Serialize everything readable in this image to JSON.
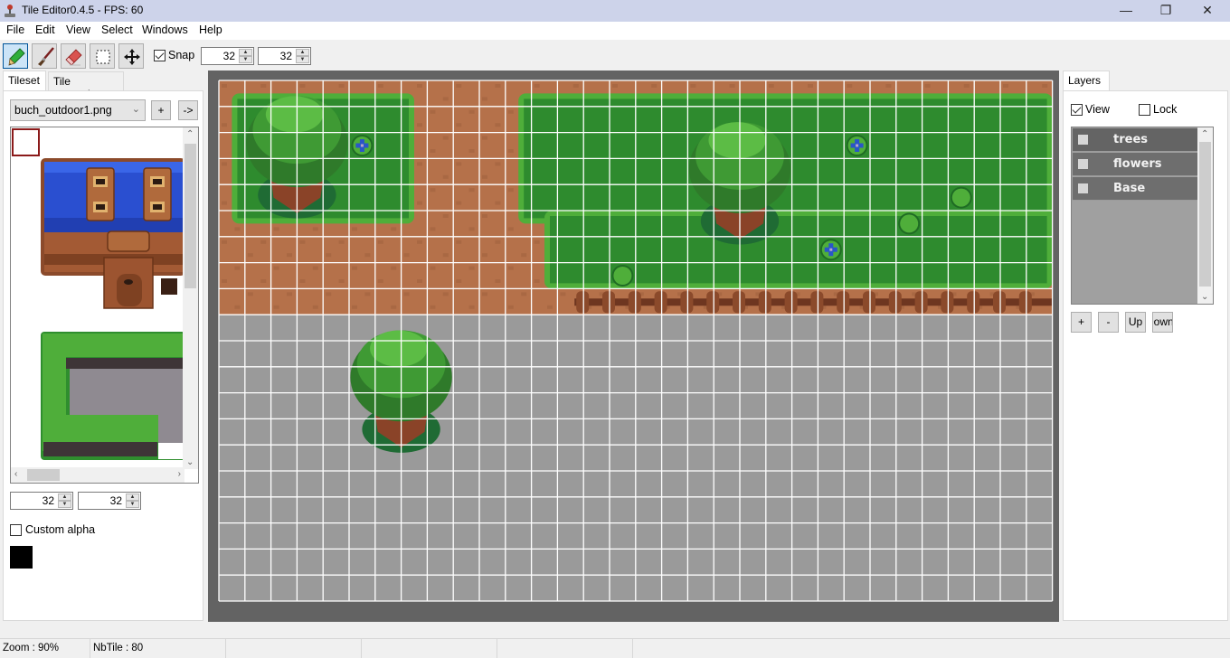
{
  "window": {
    "title": "Tile Editor0.4.5 - FPS: 60",
    "controls": {
      "minimize": "—",
      "maximize": "❐",
      "close": "✕"
    }
  },
  "menu": [
    "File",
    "Edit",
    "View",
    "Select",
    "Windows",
    "Help"
  ],
  "toolbar": {
    "tools": [
      {
        "name": "pencil-tool",
        "icon": "pencil-icon",
        "active": true
      },
      {
        "name": "brush-tool",
        "icon": "brush-icon",
        "active": false
      },
      {
        "name": "eraser-tool",
        "icon": "eraser-icon",
        "active": false
      },
      {
        "name": "select-tool",
        "icon": "selection-rect-icon",
        "active": false
      },
      {
        "name": "move-tool",
        "icon": "move-arrows-icon",
        "active": false
      }
    ],
    "snap_label": "Snap",
    "snap_checked": true,
    "snap_width": "32",
    "snap_height": "32"
  },
  "left_panel": {
    "tabs": [
      {
        "label": "Tileset",
        "selected": true
      },
      {
        "label": "Tile properties",
        "selected": false
      }
    ],
    "tileset_file": "buch_outdoor1.png",
    "add_button": "+",
    "next_button": "->",
    "tile_width": "32",
    "tile_height": "32",
    "custom_alpha_label": "Custom alpha",
    "custom_alpha_checked": false,
    "alpha_color": "#000000"
  },
  "map": {
    "columns": 32,
    "rows": 20,
    "tile_size": 32,
    "zoom_percent": 90,
    "colors": {
      "dirt": "#b5714a",
      "dirt_dark": "#9e5f3c",
      "grass": "#2e8b2e",
      "grass_edge": "#4fae3a",
      "grass_edge_dark": "#1f6b24",
      "empty": "#9a9a9a",
      "grid": "#ffffff",
      "flower": "#2a56c8",
      "trunk": "#8a4328",
      "canopy": "#3f9a34",
      "canopy_light": "#5cbc45",
      "fence": "#8b4a2b"
    },
    "painted_rows": 9,
    "grass_areas": [
      {
        "col": 0.5,
        "row": 0.5,
        "cols": 7,
        "rows": 5
      },
      {
        "col": 11.5,
        "row": 0.5,
        "cols": 20.5,
        "rows": 5
      },
      {
        "col": 12.5,
        "row": 5,
        "cols": 19.5,
        "rows": 3
      }
    ],
    "trees": [
      {
        "col": 1,
        "row": 0,
        "layer": "trees"
      },
      {
        "col": 18,
        "row": 1,
        "layer": "trees"
      },
      {
        "col": 5,
        "row": 9,
        "layer": "trees"
      }
    ],
    "flowers": [
      {
        "col": 5,
        "row": 2,
        "kind": "blue"
      },
      {
        "col": 24,
        "row": 2,
        "kind": "blue"
      },
      {
        "col": 23,
        "row": 6,
        "kind": "blue"
      },
      {
        "col": 28,
        "row": 4,
        "kind": "bush"
      },
      {
        "col": 26,
        "row": 5,
        "kind": "bush"
      },
      {
        "col": 15,
        "row": 7,
        "kind": "bush"
      }
    ],
    "fence": {
      "row": 8,
      "from_col": 14,
      "to_col": 31
    }
  },
  "right_panel": {
    "tab": "Layers",
    "view_label": "View",
    "view_checked": true,
    "lock_label": "Lock",
    "lock_checked": false,
    "layers": [
      {
        "name": "trees",
        "selected": true
      },
      {
        "name": "flowers",
        "selected": false
      },
      {
        "name": "Base",
        "selected": false
      }
    ],
    "buttons": [
      "+",
      "-",
      "Up",
      "Down"
    ]
  },
  "status": {
    "zoom": "Zoom : 90%",
    "tiles": "NbTile : 80"
  }
}
